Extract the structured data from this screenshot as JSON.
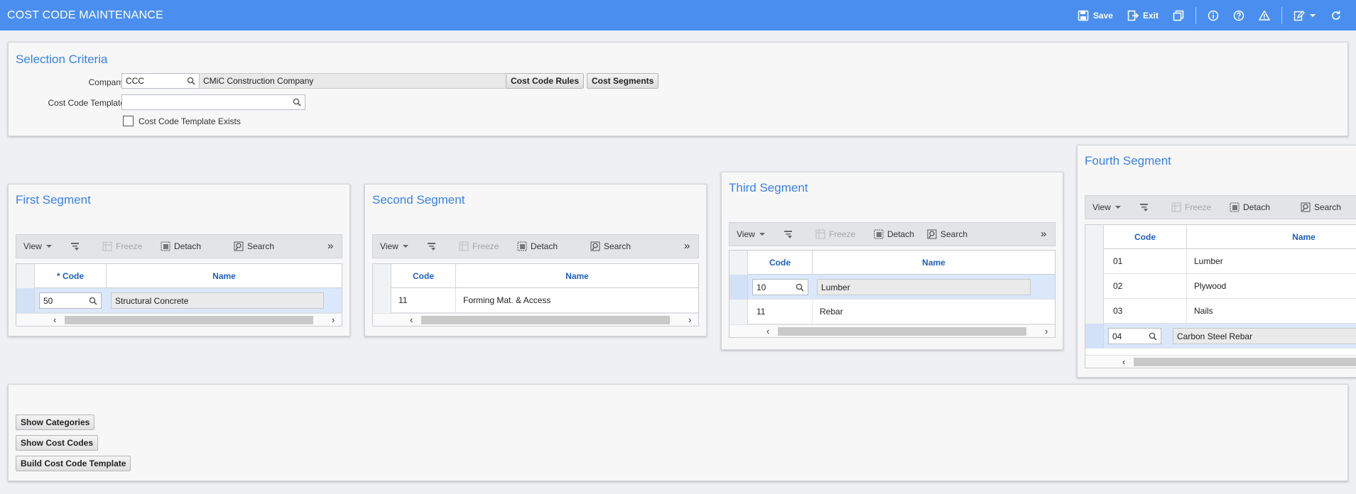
{
  "window": {
    "title": "COST CODE MAINTENANCE",
    "actions": {
      "save": "Save",
      "exit": "Exit"
    }
  },
  "selection": {
    "title": "Selection Criteria",
    "company_label": "Company",
    "company_value": "CCC",
    "company_name": "CMiC Construction Company",
    "cost_code_rules_btn": "Cost Code Rules",
    "cost_segments_btn": "Cost Segments",
    "template_label": "Cost Code Template",
    "template_value": "",
    "template_exists_label": "Cost Code Template Exists"
  },
  "toolbar": {
    "view": "View",
    "freeze": "Freeze",
    "detach": "Detach",
    "search": "Search"
  },
  "segments": {
    "first": {
      "title": "First Segment",
      "col_code": "* Code",
      "col_name": "Name",
      "rows": [
        {
          "code": "50",
          "name": "Structural Concrete"
        }
      ]
    },
    "second": {
      "title": "Second Segment",
      "col_code": "Code",
      "col_name": "Name",
      "rows": [
        {
          "code": "11",
          "name": "Forming Mat. & Access"
        }
      ]
    },
    "third": {
      "title": "Third Segment",
      "col_code": "Code",
      "col_name": "Name",
      "rows": [
        {
          "code": "10",
          "name": "Lumber"
        },
        {
          "code": "11",
          "name": "Rebar"
        }
      ]
    },
    "fourth": {
      "title": "Fourth Segment",
      "col_code": "Code",
      "col_name": "Name",
      "rows": [
        {
          "code": "01",
          "name": "Lumber"
        },
        {
          "code": "02",
          "name": "Plywood"
        },
        {
          "code": "03",
          "name": "Nails"
        },
        {
          "code": "04",
          "name": "Carbon Steel Rebar"
        }
      ]
    }
  },
  "actions": {
    "show_categories": "Show Categories",
    "show_cost_codes": "Show Cost Codes",
    "build_template": "Build Cost Code Template"
  },
  "colors": {
    "header": "#4a8ff0",
    "accent_title": "#3a82e0",
    "column_header": "#1f5fbf",
    "selected_row": "#dbe8fb"
  }
}
